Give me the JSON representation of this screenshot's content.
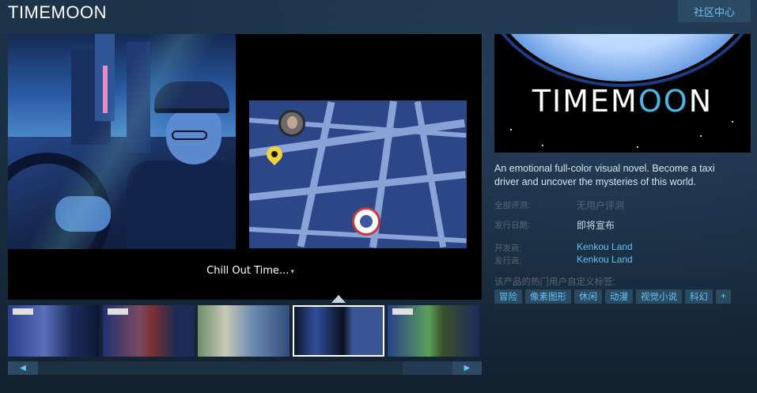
{
  "header": {
    "title": "TIMEMOON",
    "community_hub": "社区中心"
  },
  "media": {
    "caption": "Chill Out Time...",
    "caption_arrow": "▾"
  },
  "thumbnails": [
    {
      "name": "screenshot-1",
      "selected": false
    },
    {
      "name": "screenshot-2",
      "selected": false
    },
    {
      "name": "screenshot-3",
      "selected": false
    },
    {
      "name": "screenshot-4",
      "selected": true
    },
    {
      "name": "screenshot-5",
      "selected": false
    }
  ],
  "scroll": {
    "left_icon": "◀",
    "right_icon": "▶"
  },
  "capsule": {
    "logo_part1": "TIMEM",
    "logo_o1": "O",
    "logo_o2": "O",
    "logo_part2": "N"
  },
  "description": "An emotional full-color visual novel. Become a taxi driver and uncover the mysteries of this world.",
  "info": {
    "all_reviews_label": "全部评测:",
    "all_reviews_value": "无用户评测",
    "release_label": "发行日期:",
    "release_value": "即将宣布",
    "developer_label": "开发商:",
    "developer_value": "Kenkou Land",
    "publisher_label": "发行商:",
    "publisher_value": "Kenkou Land"
  },
  "tags": {
    "label": "该产品的热门用户自定义标签:",
    "items": [
      "冒险",
      "像素图形",
      "休闲",
      "动漫",
      "视觉小说",
      "科幻",
      "+"
    ]
  },
  "colors": {
    "background": "#1b2838",
    "accent": "#67c1f5",
    "tag_bg": "#2a4a61"
  }
}
